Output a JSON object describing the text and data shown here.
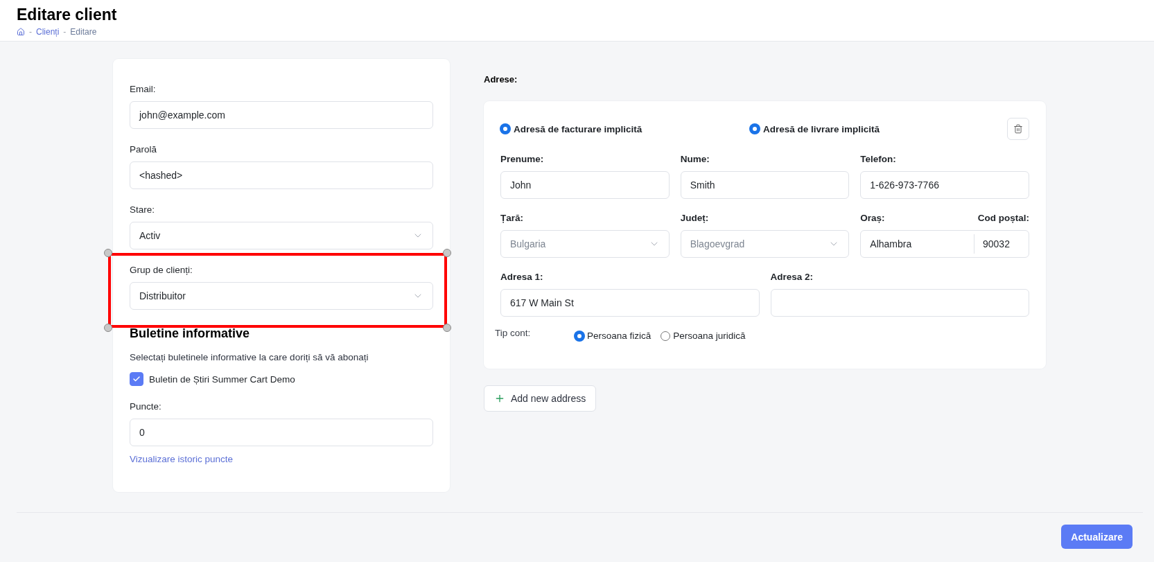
{
  "header": {
    "title": "Editare client",
    "breadcrumb": [
      {
        "kind": "home"
      },
      {
        "kind": "link",
        "label": "Clienți"
      },
      {
        "kind": "current",
        "label": "Editare"
      }
    ],
    "separator": "-"
  },
  "account": {
    "fields": [
      {
        "label": "Email:",
        "kind": "text",
        "value": "john@example.com",
        "highlighted": false
      },
      {
        "label": "Parolă",
        "kind": "text",
        "value": "<hashed>",
        "highlighted": false
      },
      {
        "label": "Stare:",
        "kind": "select",
        "value": "Activ",
        "highlighted": false
      },
      {
        "label": "Grup de clienți:",
        "kind": "select",
        "value": "Distribuitor",
        "highlighted": true
      }
    ],
    "newsletters": {
      "title": "Buletine informative",
      "description": "Selectați buletinele informative la care doriți să vă abonați",
      "items": [
        {
          "label": "Buletin de Știri Summer Cart Demo",
          "checked": true
        }
      ]
    },
    "points": {
      "label": "Puncte:",
      "value": "0",
      "link": "Vizualizare istoric puncte"
    }
  },
  "addresses": {
    "title": "Adrese:",
    "cards": [
      {
        "defaults": [
          {
            "label": "Adresă de facturare implicită",
            "checked": true
          },
          {
            "label": "Adresă de livrare implicită",
            "checked": true
          }
        ],
        "rows": [
          [
            {
              "kind": "text",
              "label": "Prenume:",
              "value": "John",
              "disabled": false
            },
            {
              "kind": "text",
              "label": "Nume:",
              "value": "Smith",
              "disabled": false
            },
            {
              "kind": "text",
              "label": "Telefon:",
              "value": "1-626-973-7766",
              "disabled": false
            }
          ],
          [
            {
              "kind": "select",
              "label": "Țară:",
              "value": "Bulgaria",
              "disabled": true
            },
            {
              "kind": "select",
              "label": "Județ:",
              "value": "Blagoevgrad",
              "disabled": true
            },
            {
              "kind": "split",
              "label": "Oraș:",
              "value": "Alhambra",
              "label2": "Cod poștal:",
              "value2": "90032"
            }
          ],
          [
            {
              "kind": "text",
              "label": "Adresa 1:",
              "value": "617 W Main St",
              "disabled": false
            },
            {
              "kind": "text",
              "label": "Adresa 2:"
            }
          ]
        ],
        "account_type": {
          "label": "Tip cont:",
          "options": [
            {
              "label": "Persoana fizică",
              "selected": true
            },
            {
              "label": "Persoana juridică",
              "selected": false
            }
          ]
        }
      }
    ],
    "add_button": "Add new address"
  },
  "footer": {
    "submit": "Actualizare"
  }
}
